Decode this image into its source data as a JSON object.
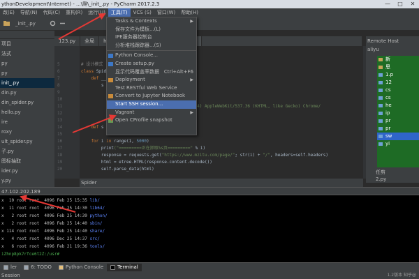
{
  "window": {
    "title": "ythonDevelopment\\Internet) - ...\\爬\\_init_.py - PyCharm 2017.2.3",
    "controls": [
      "—",
      "□",
      "✕"
    ]
  },
  "menubar": {
    "items": [
      "改(E)",
      "导航(N)",
      "代码(C)",
      "重构(R)",
      "运行(U)",
      "工具(T)",
      "VCS (S)",
      "窗口(W)",
      "帮助(H)"
    ],
    "active_index": 5
  },
  "breadcrumb": "_init_.py",
  "left_panel": {
    "items": [
      "项目",
      "法式",
      "py",
      "py",
      "init_.py",
      "din.py",
      "din_spider.py",
      "hello.py",
      "ire",
      "roxy",
      "ult_spider.py",
      "子.py",
      "图标抽取",
      "ider.py",
      "y.py",
      "py",
      "py"
    ],
    "selected_index": 4
  },
  "editor_tabs": {
    "items": [
      "123.py",
      "全局",
      "hello.py",
      "csdn_spider.py",
      "_init_.py"
    ],
    "active_index": 4
  },
  "code": {
    "lines": [
      {
        "n": "5",
        "parts": [
          {
            "t": "# 设计模式",
            "c": "cmt"
          }
        ]
      },
      {
        "n": "6",
        "parts": [
          {
            "t": "class ",
            "c": "kw"
          },
          {
            "t": "Spider",
            "c": ""
          }
        ]
      },
      {
        "n": "7",
        "parts": [
          {
            "t": "    def ",
            "c": "kw"
          },
          {
            "t": "__",
            "c": ""
          }
        ]
      },
      {
        "n": "8",
        "parts": [
          {
            "t": "        s",
            "c": ""
          }
        ]
      },
      {
        "n": "9",
        "parts": [
          {
            "t": "",
            "c": ""
          }
        ]
      },
      {
        "n": "10",
        "parts": [
          {
            "t": "",
            "c": ""
          }
        ]
      },
      {
        "n": "11",
        "parts": [
          {
            "t": "                                 ",
            "c": ""
          },
          {
            "t": "NT 10.0; WOW64) AppleWebKit/537.36 (KHTML, like Gecko) Chrome/",
            "c": "str"
          }
        ]
      },
      {
        "n": "12",
        "parts": [
          {
            "t": "                                 ",
            "c": ""
          },
          {
            "t": "singapore\"",
            "c": "str"
          }
        ]
      },
      {
        "n": "13",
        "parts": [
          {
            "t": "",
            "c": ""
          }
        ]
      },
      {
        "n": "14",
        "parts": [
          {
            "t": "    def ",
            "c": "kw"
          },
          {
            "t": "s",
            "c": ""
          }
        ]
      },
      {
        "n": "15",
        "parts": [
          {
            "t": "        ",
            "c": ""
          }
        ]
      },
      {
        "n": "16",
        "parts": [
          {
            "t": "    for ",
            "c": "kw"
          },
          {
            "t": "i ",
            "c": ""
          },
          {
            "t": "in ",
            "c": "kw"
          },
          {
            "t": "range(1, ",
            "c": ""
          },
          {
            "t": "5000",
            "c": "num"
          },
          {
            "t": ")",
            "c": ""
          }
        ]
      },
      {
        "n": "17",
        "parts": [
          {
            "t": "        print",
            "c": ""
          },
          {
            "t": "(\"=========正在抓取%s页=========\"",
            "c": "str"
          },
          {
            "t": " % i)",
            "c": ""
          }
        ]
      },
      {
        "n": "18",
        "parts": [
          {
            "t": "        response = requests.get(",
            "c": ""
          },
          {
            "t": "\"https://www.mzitu.com/page/\"",
            "c": "str"
          },
          {
            "t": "; str(i) + ",
            "c": ""
          },
          {
            "t": "\"/\"",
            "c": "str"
          },
          {
            "t": ", headers=self.headers)",
            "c": ""
          }
        ]
      },
      {
        "n": "19",
        "parts": [
          {
            "t": "        html = etree.HTML(response.content.decode())",
            "c": ""
          }
        ]
      },
      {
        "n": "20",
        "parts": [
          {
            "t": "        self.parse_data(html)",
            "c": ""
          }
        ]
      }
    ]
  },
  "struct_bar": "Spider",
  "menu": {
    "items": [
      {
        "label": "Tasks & Contexts",
        "shortcut": "",
        "submenu": true,
        "icon": "",
        "sep_after": false
      },
      {
        "label": "保存文件为模板...(L)",
        "shortcut": "",
        "submenu": false,
        "icon": "",
        "sep_after": false
      },
      {
        "label": "IPE服务器控制台",
        "shortcut": "",
        "submenu": false,
        "icon": "",
        "sep_after": false
      },
      {
        "label": "分析堆栈跟踪器...(S)",
        "shortcut": "",
        "submenu": false,
        "icon": "",
        "sep_after": true
      },
      {
        "label": "Python Console...",
        "shortcut": "",
        "submenu": false,
        "icon": "python-icon",
        "sep_after": false
      },
      {
        "label": "Create setup.py",
        "shortcut": "",
        "submenu": false,
        "icon": "python-icon",
        "sep_after": false
      },
      {
        "label": "显示代码覆盖率数据",
        "shortcut": "Ctrl+Alt+F6",
        "submenu": false,
        "icon": "",
        "sep_after": false
      },
      {
        "label": "Deployment",
        "shortcut": "",
        "submenu": true,
        "icon": "deploy-icon",
        "sep_after": false
      },
      {
        "label": "Test RESTful Web Service",
        "shortcut": "",
        "submenu": false,
        "icon": "",
        "sep_after": false
      },
      {
        "label": "Convert to Jupyter Notebook",
        "shortcut": "",
        "submenu": false,
        "icon": "notebook-icon",
        "sep_after": false
      },
      {
        "label": "Start SSH session...",
        "shortcut": "",
        "submenu": false,
        "icon": "",
        "sep_after": false
      },
      {
        "label": "Vagrant",
        "shortcut": "",
        "submenu": true,
        "icon": "",
        "sep_after": false
      },
      {
        "label": "Open CProfile snapshot",
        "shortcut": "",
        "submenu": false,
        "icon": "profile-icon",
        "sep_after": false
      }
    ],
    "highlighted_index": 10
  },
  "remote_host": {
    "title": "Remote Host",
    "server": "aliyu",
    "items": [
      {
        "label": "新",
        "type": "folder"
      },
      {
        "label": "思",
        "type": "folder"
      },
      {
        "label": "1.p",
        "type": "file"
      },
      {
        "label": "12",
        "type": "file"
      },
      {
        "label": "cs",
        "type": "file"
      },
      {
        "label": "cs",
        "type": "file"
      },
      {
        "label": "he",
        "type": "file"
      },
      {
        "label": "ip",
        "type": "file"
      },
      {
        "label": "pr",
        "type": "file"
      },
      {
        "label": "pr",
        "type": "file"
      },
      {
        "label": "sw",
        "type": "file"
      },
      {
        "label": "yi",
        "type": "file"
      }
    ],
    "selected_index": 10,
    "bottom": [
      "任剪",
      "2.py"
    ]
  },
  "terminal": {
    "title": "47.102.202.189",
    "lines": [
      {
        "perm": "x  10 root root  4096 Feb 25 15:35 ",
        "name": "lib/",
        "dir": true
      },
      {
        "perm": "x  11 root root  4096 Feb 25 14:30 ",
        "name": "lib64/",
        "dir": true
      },
      {
        "perm": "x   2 root root  4096 Feb 25 14:39 ",
        "name": "python/",
        "dir": true
      },
      {
        "perm": "x   2 root root  4096 Feb 25 14:40 ",
        "name": "sbin/",
        "dir": true
      },
      {
        "perm": "x 114 root root  4096 Feb 25 14:40 ",
        "name": "share/",
        "dir": true
      },
      {
        "perm": "x   4 root root  4096 Dec 25 14:37 ",
        "name": "src/",
        "dir": true
      },
      {
        "perm": "x   6 root root  4096 Feb 21 19:36 ",
        "name": "tools/",
        "dir": true
      },
      {
        "perm": "",
        "name": "iZhnp8pk7rfce6t2Z:/usr#",
        "dir": false
      }
    ]
  },
  "statusbar": {
    "tool_windows": [
      {
        "label": "ler",
        "color": "#9aa5b0",
        "active": false
      },
      {
        "label": "6: TODO",
        "color": "#9aa5b0",
        "active": false
      },
      {
        "label": "Python Console",
        "color": "#e5c07b",
        "active": false
      },
      {
        "label": "Terminal",
        "color": "#000000",
        "active": true
      }
    ],
    "text": "Session",
    "watermark": "1.2版本  知乎@"
  },
  "colors": {
    "menu_highlight": "#4b6eaf",
    "remote_tree_bg": "#1e6b25",
    "annotation_arrow": "#e53935"
  }
}
